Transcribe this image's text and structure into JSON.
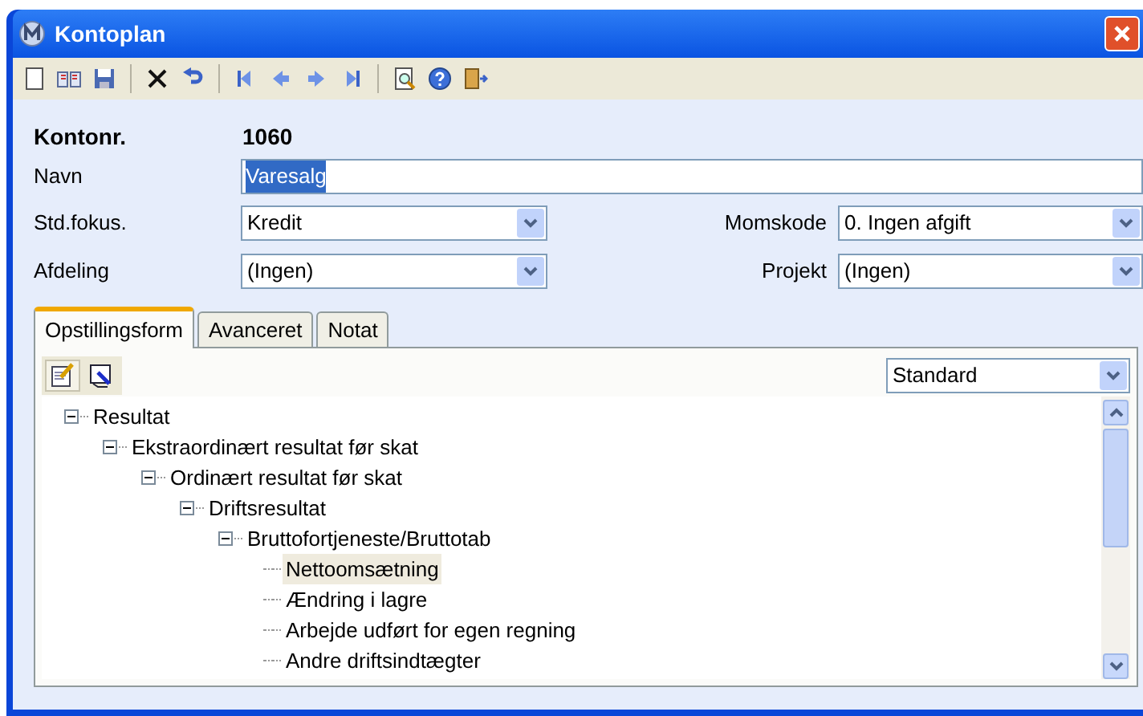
{
  "window": {
    "title": "Kontoplan"
  },
  "form": {
    "account_number_label": "Kontonr.",
    "account_number": "1060",
    "name": {
      "label": "Navn",
      "value": "Varesalg",
      "text_selected": true
    },
    "std_focus": {
      "label": "Std.fokus.",
      "value": "Kredit"
    },
    "vat_code": {
      "label": "Momskode",
      "value": "0. Ingen afgift"
    },
    "department": {
      "label": "Afdeling",
      "value": "(Ingen)"
    },
    "project": {
      "label": "Projekt",
      "value": "(Ingen)"
    }
  },
  "tabs": [
    {
      "label": "Opstillingsform",
      "selected": true
    },
    {
      "label": "Avanceret",
      "selected": false
    },
    {
      "label": "Notat",
      "selected": false
    }
  ],
  "layout_select": {
    "value": "Standard"
  },
  "tree": [
    {
      "label": "Resultat",
      "expanded": true,
      "selected": false,
      "children": [
        {
          "label": "Ekstraordinært resultat før skat",
          "expanded": true,
          "selected": false,
          "children": [
            {
              "label": "Ordinært resultat før skat",
              "expanded": true,
              "selected": false,
              "children": [
                {
                  "label": "Driftsresultat",
                  "expanded": true,
                  "selected": false,
                  "children": [
                    {
                      "label": "Bruttofortjeneste/Bruttotab",
                      "expanded": true,
                      "selected": false,
                      "children": [
                        {
                          "label": "Nettoomsætning",
                          "selected": true
                        },
                        {
                          "label": "Ændring i lagre",
                          "selected": false
                        },
                        {
                          "label": "Arbejde udført for egen regning",
                          "selected": false
                        },
                        {
                          "label": "Andre driftsindtægter",
                          "selected": false
                        }
                      ]
                    }
                  ]
                }
              ]
            }
          ]
        }
      ]
    }
  ]
}
